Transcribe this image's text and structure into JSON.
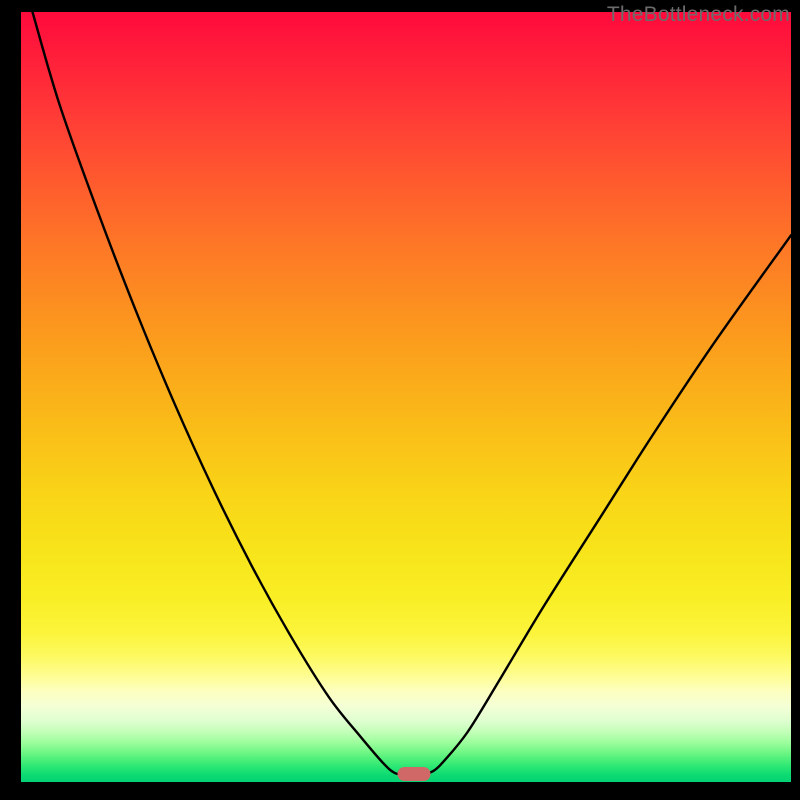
{
  "watermark": "TheBottleneck.com",
  "marker": {
    "x_pct": 51.0,
    "y_pct": 99.0,
    "color": "#d06868"
  },
  "chart_data": {
    "type": "line",
    "title": "",
    "xlabel": "",
    "ylabel": "",
    "xlim": [
      0,
      100
    ],
    "ylim": [
      0,
      100
    ],
    "note": "Values are percentages of the plot area. y=0 is the top edge (red), y=100 is the bottom edge (green). The curve is a V-shaped bottleneck profile descending from top-left, flattening briefly near the bottom around x≈48–53, then rising toward the right.",
    "series": [
      {
        "name": "bottleneck-curve",
        "x": [
          1.5,
          5,
          10,
          15,
          20,
          25,
          30,
          35,
          40,
          44,
          47,
          48.5,
          50,
          52,
          53.5,
          55,
          58,
          62,
          68,
          75,
          82,
          90,
          100
        ],
        "y": [
          0,
          12,
          26,
          39,
          51,
          62,
          72,
          81,
          89,
          94,
          97.5,
          98.8,
          99.1,
          99.0,
          98.6,
          97.2,
          93.5,
          87,
          77,
          66,
          55,
          43,
          29
        ]
      }
    ],
    "background_gradient": {
      "direction": "vertical",
      "stops": [
        {
          "pct": 0,
          "color": "#ff0a3c"
        },
        {
          "pct": 38,
          "color": "#fc8f20"
        },
        {
          "pct": 70,
          "color": "#f8e41a"
        },
        {
          "pct": 88,
          "color": "#fdffc0"
        },
        {
          "pct": 95,
          "color": "#98fd9a"
        },
        {
          "pct": 100,
          "color": "#02d373"
        }
      ]
    }
  }
}
